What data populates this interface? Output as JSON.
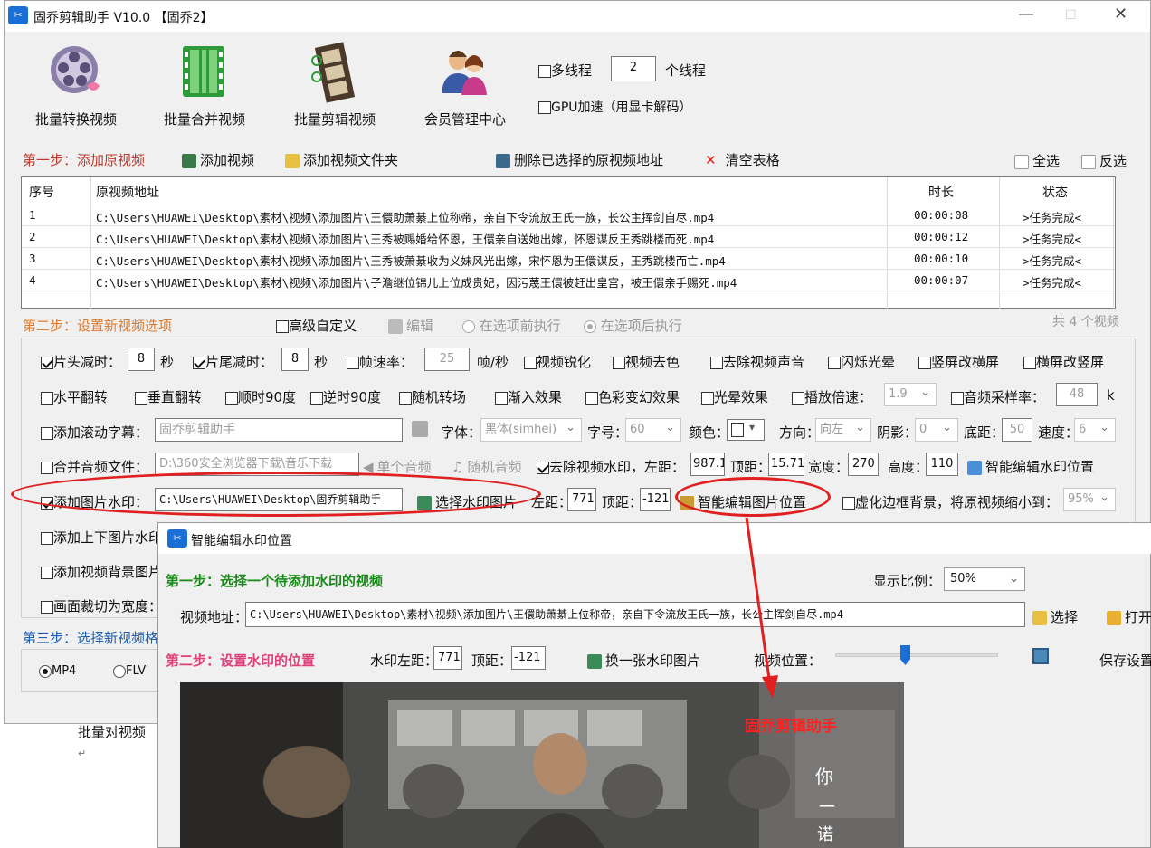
{
  "app": {
    "title": "固乔剪辑助手 V10.0 【固乔2】",
    "icon_label": "固乔"
  },
  "window_controls": {
    "minimize": "—",
    "maximize": "☐",
    "close": "✕"
  },
  "toolbar": {
    "items": [
      {
        "label": "批量转换视频",
        "icon": "film-reel-icon"
      },
      {
        "label": "批量合并视频",
        "icon": "film-strip-green-icon"
      },
      {
        "label": "批量剪辑视频",
        "icon": "film-cut-icon"
      },
      {
        "label": "会员管理中心",
        "icon": "users-icon"
      }
    ],
    "multithread_label": "多线程",
    "thread_count": "2",
    "thread_unit": "个线程",
    "gpu_label": "GPU加速（用显卡解码）"
  },
  "step1": {
    "title": "第一步：添加原视频",
    "add_video": "添加视频",
    "add_folder": "添加视频文件夹",
    "delete_selected": "删除已选择的原视频地址",
    "clear_table": "清空表格",
    "select_all": "全选",
    "invert_select": "反选"
  },
  "table": {
    "headers": {
      "index": "序号",
      "path": "原视频地址",
      "duration": "时长",
      "status": "状态"
    },
    "rows": [
      {
        "index": "1",
        "path": "C:\\Users\\HUAWEI\\Desktop\\素材\\视频\\添加图片\\王儇助萧綦上位称帝，亲自下令流放王氏一族，长公主挥剑自尽.mp4",
        "duration": "00:00:08",
        "status": ">任务完成<"
      },
      {
        "index": "2",
        "path": "C:\\Users\\HUAWEI\\Desktop\\素材\\视频\\添加图片\\王秀被赐婚给怀恩，王儇亲自送她出嫁，怀恩谋反王秀跳楼而死.mp4",
        "duration": "00:00:12",
        "status": ">任务完成<"
      },
      {
        "index": "3",
        "path": "C:\\Users\\HUAWEI\\Desktop\\素材\\视频\\添加图片\\王秀被萧綦收为义妹风光出嫁，宋怀恩为王儇谋反，王秀跳楼而亡.mp4",
        "duration": "00:00:10",
        "status": ">任务完成<"
      },
      {
        "index": "4",
        "path": "C:\\Users\\HUAWEI\\Desktop\\素材\\视频\\添加图片\\子澹继位锦儿上位成贵妃，因污蔑王儇被赶出皇宫，被王儇亲手赐死.mp4",
        "duration": "00:00:07",
        "status": ">任务完成<"
      }
    ]
  },
  "step2": {
    "title": "第二步：设置新视频选项",
    "advanced": "高级自定义",
    "edit": "编辑",
    "exec_before": "在选项前执行",
    "exec_after": "在选项后执行",
    "count": "共 4 个视频"
  },
  "options": {
    "head_cut": "片头减时：",
    "head_val": "8",
    "sec": "秒",
    "tail_cut": "片尾减时：",
    "tail_val": "8",
    "fps": "帧速率：",
    "fps_val": "25",
    "fps_unit": "帧/秒",
    "sharpen": "视频锐化",
    "decolor": "视频去色",
    "mute": "去除视频声音",
    "flash": "闪烁光晕",
    "v2h": "竖屏改横屏",
    "h2v": "横屏改竖屏",
    "hflip": "水平翻转",
    "vflip": "垂直翻转",
    "rot_cw": "顺时90度",
    "rot_ccw": "逆时90度",
    "random_trans": "随机转场",
    "fade": "渐入效果",
    "color_fx": "色彩变幻效果",
    "halo": "光晕效果",
    "speed": "播放倍速：",
    "speed_val": "1.9",
    "sample": "音频采样率：",
    "sample_val": "48",
    "sample_unit": "k",
    "scroll_sub": "添加滚动字幕：",
    "scroll_text": "固乔剪辑助手",
    "font": "字体：",
    "font_val": "黑体(simhei)",
    "size": "字号：",
    "size_val": "60",
    "color": "颜色：",
    "direction": "方向：",
    "direction_val": "向左",
    "shadow": "阴影：",
    "shadow_val": "0",
    "bottom": "底距：",
    "bottom_val": "50",
    "speed2": "速度：",
    "speed2_val": "6",
    "merge_audio": "合并音频文件：",
    "audio_path": "D:\\360安全浏览器下载\\音乐下载",
    "single_audio": "单个音频",
    "random_audio": "随机音频",
    "remove_wm": "去除视频水印，左距：",
    "wm_left": "987.1",
    "wm_top_lbl": "顶距：",
    "wm_top": "15.71",
    "wm_w_lbl": "宽度：",
    "wm_w": "270",
    "wm_h_lbl": "高度：",
    "wm_h": "110",
    "smart_wm": "智能编辑水印位置",
    "add_img_wm": "添加图片水印：",
    "img_path": "C:\\Users\\HUAWEI\\Desktop\\固乔剪辑助手",
    "choose_img": "选择水印图片",
    "left_lbl": "左距：",
    "left_val": "771",
    "top_lbl": "顶距：",
    "top_val": "-121",
    "smart_img": "智能编辑图片位置",
    "blur_border": "虚化边框背景，将原视频缩小到：",
    "blur_val": "95%",
    "add_updown": "添加上下图片水印",
    "add_bg": "添加视频背景图片",
    "crop": "画面裁切为宽度："
  },
  "step3": {
    "title": "第三步：选择新视频格式",
    "mp4": "MP4",
    "flv": "FLV"
  },
  "doc_text": {
    "line1": "批量对视频",
    "mark": "↵"
  },
  "dialog": {
    "title": "智能编辑水印位置",
    "step1": "第一步：选择一个待添加水印的视频",
    "ratio_lbl": "显示比例：",
    "ratio_val": "50%",
    "path_lbl": "视频地址：",
    "path_val": "C:\\Users\\HUAWEI\\Desktop\\素材\\视频\\添加图片\\王儇助萧綦上位称帝，亲自下令流放王氏一族，长公主挥剑自尽.mp4",
    "choose": "选择",
    "open": "打开",
    "step2": "第二步：设置水印的位置",
    "wm_left_lbl": "水印左距：",
    "wm_left": "771",
    "wm_top_lbl": "顶距：",
    "wm_top": "-121",
    "change_img": "换一张水印图片",
    "pos_lbl": "视频位置：",
    "save": "保存设置",
    "overlay_text": "固乔剪辑助手",
    "sub1": "你",
    "sub2": "一",
    "sub3": "诺"
  },
  "colors": {
    "annotation_red": "#e02020",
    "step_red": "#c0392b",
    "step_orange": "#e07a2b",
    "step_blue": "#1a5fb4",
    "green": "#1a8a1a",
    "pink": "#e0407a",
    "accent": "#1a6fd6"
  }
}
